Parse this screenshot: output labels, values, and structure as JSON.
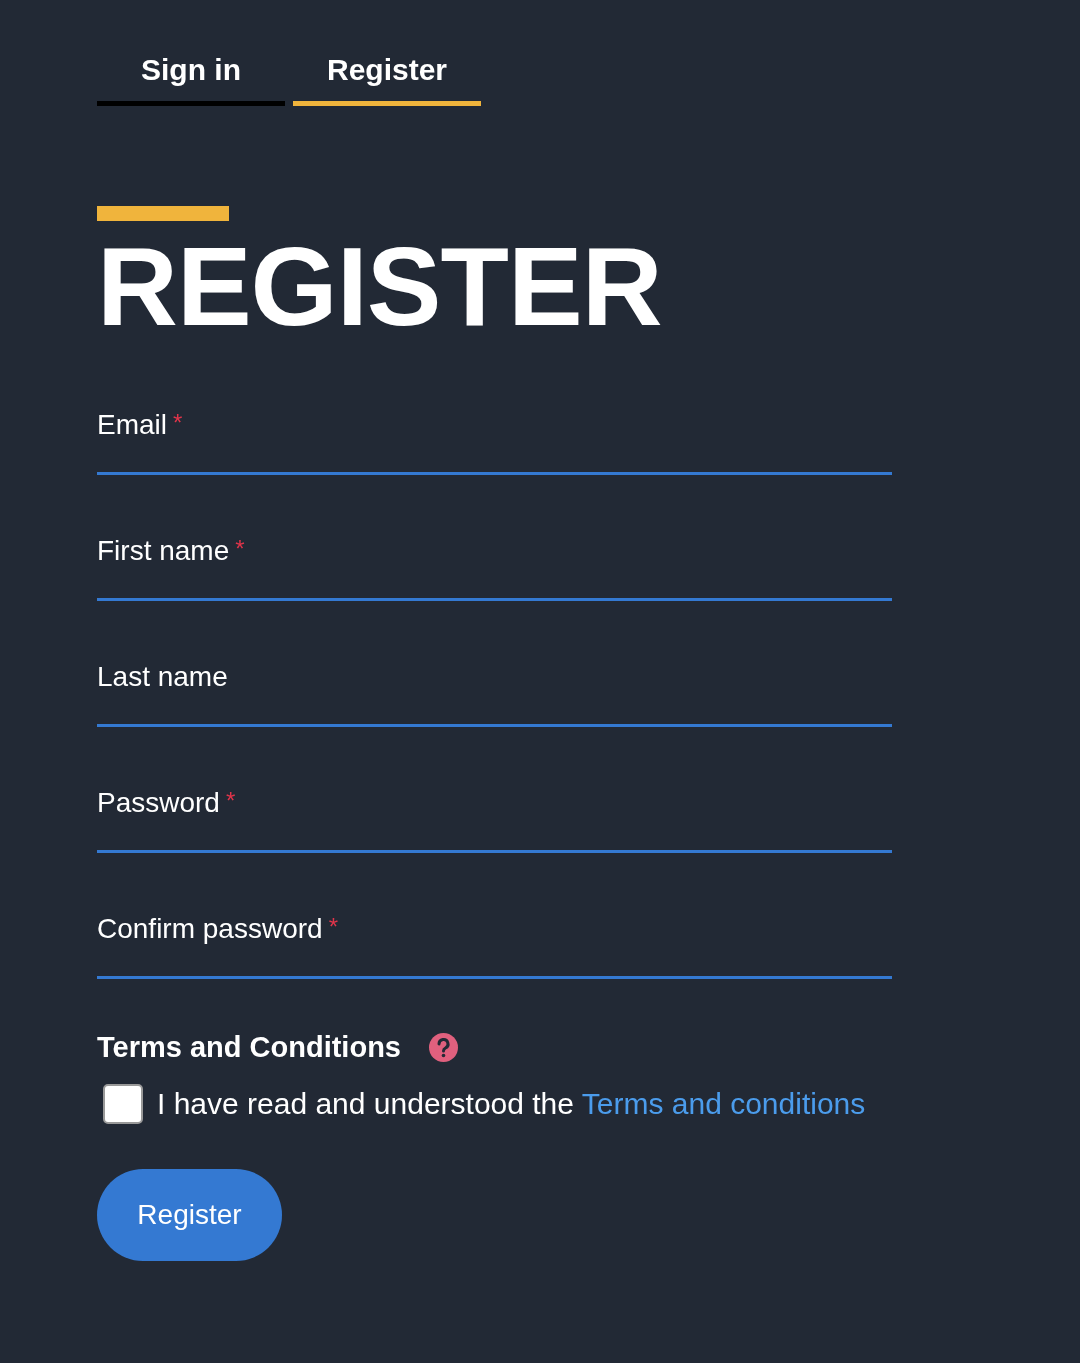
{
  "tabs": [
    {
      "label": "Sign in",
      "selected": false
    },
    {
      "label": "Register",
      "selected": true
    }
  ],
  "heading": "REGISTER",
  "fields": [
    {
      "label": "Email",
      "marker": "*"
    },
    {
      "label": "First name",
      "marker": "*"
    },
    {
      "label": "Last name"
    },
    {
      "label": "Password",
      "marker": "*"
    },
    {
      "label": "Confirm password",
      "marker": "*"
    }
  ],
  "terms": {
    "title": "Terms and Conditions",
    "checkbox": {
      "checked": false,
      "text": "I have read and understood the ",
      "link": "Terms and conditions"
    }
  },
  "button": "Register"
}
